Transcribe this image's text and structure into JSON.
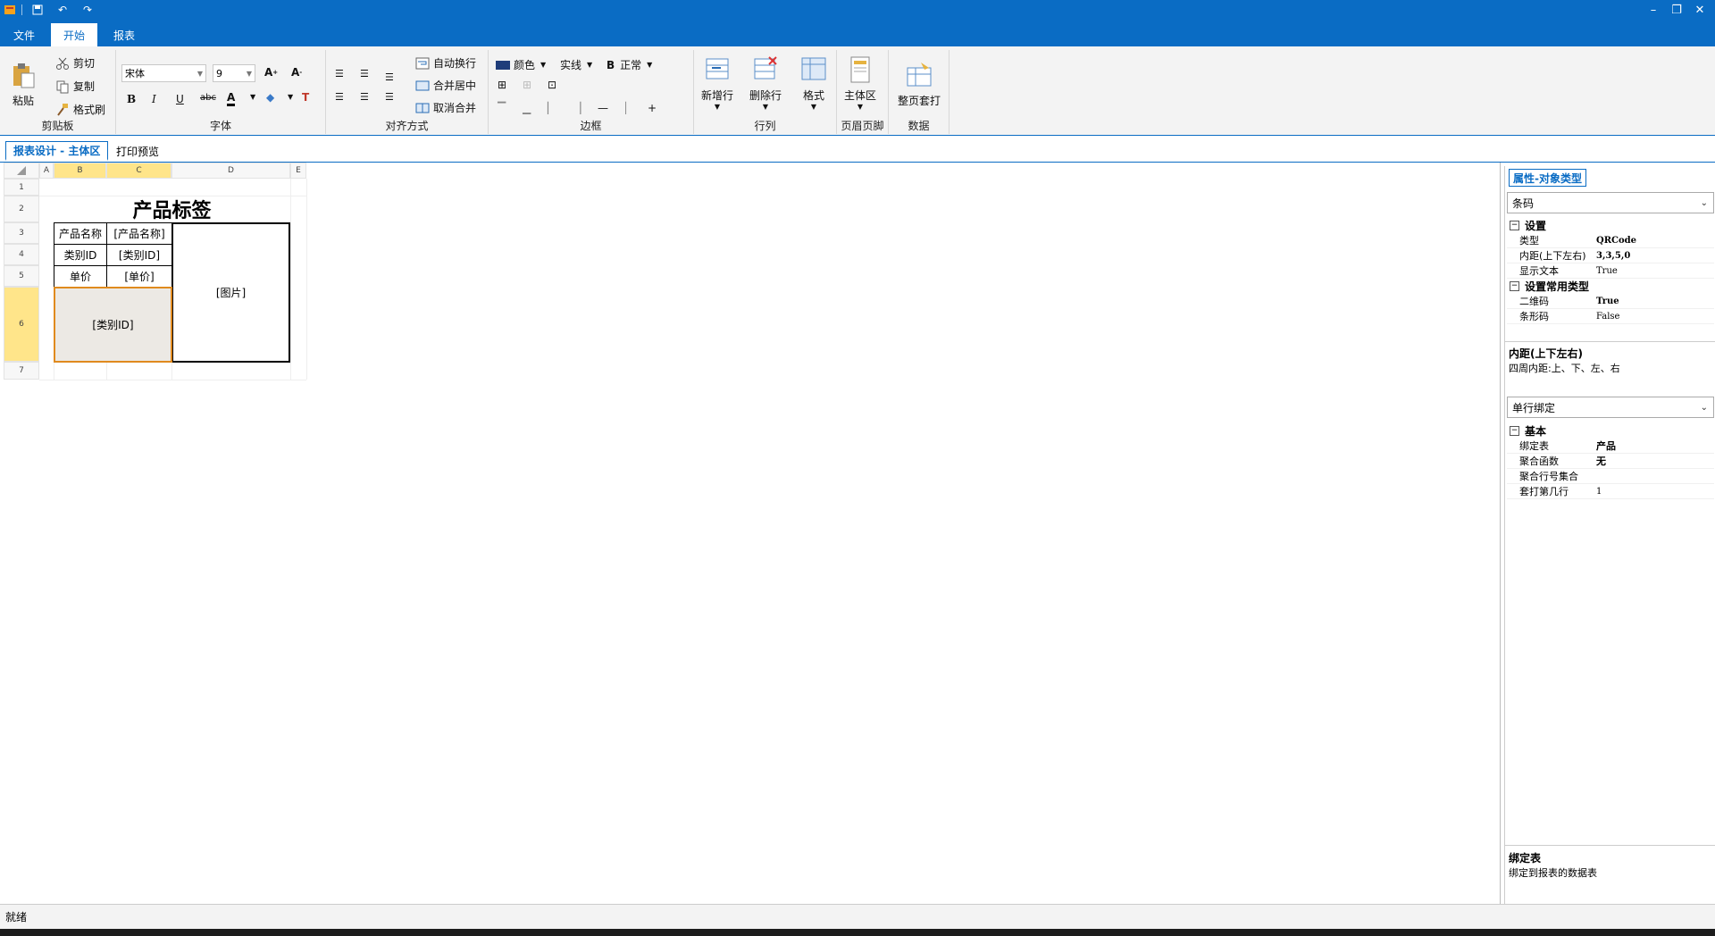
{
  "menu": {
    "tabs": [
      "文件",
      "开始",
      "报表"
    ],
    "active_index": 1
  },
  "ribbon": {
    "clipboard": {
      "label": "剪贴板",
      "paste": "粘贴",
      "cut": "剪切",
      "copy": "复制",
      "format_painter": "格式刷"
    },
    "font": {
      "label": "字体",
      "family": "宋体",
      "size": "9"
    },
    "alignment": {
      "label": "对齐方式",
      "wrap": "自动换行",
      "merge_center": "合并居中",
      "unmerge": "取消合并"
    },
    "border": {
      "label": "边框",
      "color": "颜色",
      "line_style": "实线",
      "weight": "正常"
    },
    "rowcol": {
      "label": "行列",
      "add_row": "新增行",
      "delete_row": "删除行",
      "format": "格式"
    },
    "header_footer": {
      "label": "页眉页脚",
      "main_area": "主体区"
    },
    "data": {
      "label": "数据",
      "full_page_print": "整页套打"
    }
  },
  "doc_tabs": [
    "报表设计 - 主体区",
    "打印预览"
  ],
  "sheet": {
    "columns": [
      "A",
      "B",
      "C",
      "D",
      "E"
    ],
    "rows": [
      "1",
      "2",
      "3",
      "4",
      "5",
      "6",
      "7"
    ],
    "title": "产品标签",
    "cells": {
      "b3": "产品名称",
      "c3": "[产品名称]",
      "b4": "类别ID",
      "c4": "[类别ID]",
      "b5": "单价",
      "c5": "[单价]",
      "d3": "[图片]",
      "b6": "[类别ID]"
    }
  },
  "props": {
    "tab": "属性-对象类型",
    "object_type": "条码",
    "cat_settings": "设置",
    "settings": [
      {
        "k": "类型",
        "v": "QRCode"
      },
      {
        "k": "内距(上下左右)",
        "v": "3,3,5,0"
      },
      {
        "k": "显示文本",
        "v": "True"
      }
    ],
    "cat_common": "设置常用类型",
    "common": [
      {
        "k": "二维码",
        "v": "True"
      },
      {
        "k": "条形码",
        "v": "False"
      }
    ],
    "desc1_title": "内距(上下左右)",
    "desc1_text": "四周内距:上、下、左、右",
    "binding_type": "单行绑定",
    "cat_basic": "基本",
    "basic": [
      {
        "k": "绑定表",
        "v": "产品"
      },
      {
        "k": "聚合函数",
        "v": "无"
      },
      {
        "k": "聚合行号集合",
        "v": ""
      },
      {
        "k": "套打第几行",
        "v": "1"
      }
    ],
    "desc2_title": "绑定表",
    "desc2_text": "绑定到报表的数据表"
  },
  "status": {
    "text": "就绪"
  },
  "colors": {
    "accent": "#0a6cc4",
    "selection": "#ffe58a",
    "selected_cell_border": "#e08a1e",
    "selected_cell_fill": "#ece9e4"
  }
}
